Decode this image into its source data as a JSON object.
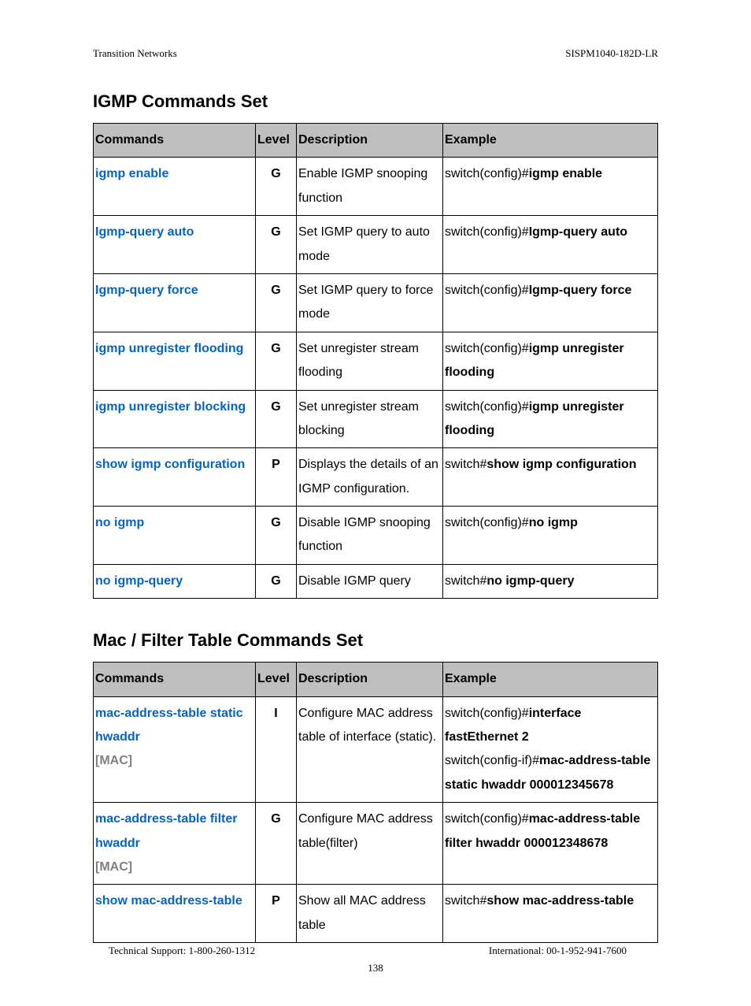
{
  "header": {
    "left": "Transition Networks",
    "right": "SISPM1040-182D-LR"
  },
  "footer": {
    "left": "Technical Support: 1-800-260-1312",
    "right": "International: 00-1-952-941-7600",
    "page": "138"
  },
  "table_headers": {
    "commands": "Commands",
    "level": "Level",
    "description": "Description",
    "example": "Example"
  },
  "sections": [
    {
      "title": "IGMP Commands Set",
      "rows": [
        {
          "command": {
            "name": "igmp enable",
            "param": ""
          },
          "level": "G",
          "description": "Enable IGMP snooping function",
          "example": [
            [
              "switch(config)#",
              "igmp enable"
            ]
          ]
        },
        {
          "command": {
            "name": "Igmp-query auto",
            "param": ""
          },
          "level": "G",
          "description": "Set IGMP query to auto mode",
          "example": [
            [
              "switch(config)#",
              "Igmp-query auto"
            ]
          ]
        },
        {
          "command": {
            "name": "Igmp-query force",
            "param": ""
          },
          "level": "G",
          "description": "Set IGMP query to force mode",
          "example": [
            [
              "switch(config)#",
              "Igmp-query force"
            ]
          ]
        },
        {
          "command": {
            "name": "igmp unregister flooding",
            "param": ""
          },
          "level": "G",
          "description": "Set unregister stream flooding",
          "example": [
            [
              "switch(config)#",
              "igmp unregister flooding"
            ]
          ]
        },
        {
          "command": {
            "name": "igmp unregister blocking",
            "param": ""
          },
          "level": "G",
          "description": "Set unregister stream blocking",
          "example": [
            [
              "switch(config)#",
              "igmp unregister flooding"
            ]
          ]
        },
        {
          "command": {
            "name": "show igmp configuration",
            "param": ""
          },
          "level": "P",
          "description": "Displays the details of an IGMP configuration.",
          "example": [
            [
              "switch#",
              "show igmp configuration"
            ]
          ]
        },
        {
          "command": {
            "name": "no igmp",
            "param": ""
          },
          "level": "G",
          "description": "Disable IGMP snooping function",
          "example": [
            [
              "switch(config)#",
              "no igmp"
            ]
          ]
        },
        {
          "command": {
            "name": "no igmp-query",
            "param": ""
          },
          "level": "G",
          "description": "Disable IGMP query",
          "example": [
            [
              "switch#",
              "no igmp-query"
            ]
          ]
        }
      ]
    },
    {
      "title": "Mac / Filter Table Commands Set",
      "rows": [
        {
          "command": {
            "name": "mac-address-table static hwaddr",
            "param": "[MAC]"
          },
          "level": "I",
          "description": "Configure MAC address table of interface (static).",
          "example": [
            [
              "switch(config)#",
              "interface fastEthernet 2"
            ],
            [
              "switch(config-if)#",
              "mac-address-table static hwaddr 000012345678"
            ]
          ]
        },
        {
          "command": {
            "name": "mac-address-table filter hwaddr",
            "param": "[MAC]"
          },
          "level": "G",
          "description": "Configure MAC address table(filter)",
          "example": [
            [
              "switch(config)#",
              "mac-address-table filter hwaddr 000012348678"
            ]
          ]
        },
        {
          "command": {
            "name": "show mac-address-table",
            "param": ""
          },
          "level": "P",
          "description": "Show all MAC address table",
          "example": [
            [
              "switch#",
              "show mac-address-table"
            ]
          ]
        }
      ]
    }
  ]
}
